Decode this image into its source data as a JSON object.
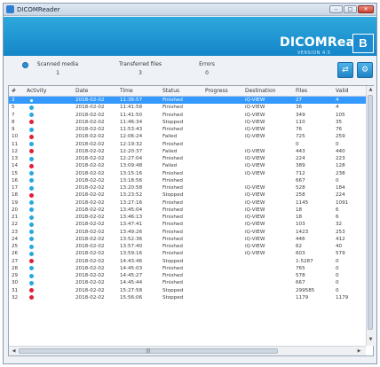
{
  "window": {
    "title": "DICOMReader",
    "min_glyph": "–",
    "max_glyph": "□",
    "close_glyph": "✕"
  },
  "banner": {
    "brand": "DICOMRead",
    "version": "VERSION 4.5",
    "badge": "B"
  },
  "status": {
    "scanned_label": "Scanned media",
    "scanned_value": "1",
    "transferred_label": "Transferred files",
    "transferred_value": "3",
    "errors_label": "Errors",
    "errors_value": "0"
  },
  "toolbar": {
    "btn1_glyph": "⇄",
    "btn2_glyph": "⚙"
  },
  "colors": {
    "accent": "#1f95d6",
    "selected_row": "#3399ff",
    "status_ok": "#2aa7e0",
    "status_error": "#e0203a"
  },
  "table": {
    "columns": [
      "#",
      "Activity",
      "Date",
      "Time",
      "Status",
      "Progress",
      "Destination",
      "Files",
      "Valid"
    ],
    "rows": [
      {
        "n": "3",
        "activity": "active",
        "date": "2018-02-02",
        "time": "11:36:57",
        "status": "Finished",
        "progress": "",
        "destination": "iQ-VIEW",
        "files": "27",
        "valid": "4",
        "selected": true
      },
      {
        "n": "5",
        "activity": "ok",
        "date": "2018-02-02",
        "time": "11:41:58",
        "status": "Finished",
        "progress": "",
        "destination": "iQ-VIEW",
        "files": "36",
        "valid": "4"
      },
      {
        "n": "7",
        "activity": "ok",
        "date": "2018-02-02",
        "time": "11:41:50",
        "status": "Finished",
        "progress": "",
        "destination": "iQ-VIEW",
        "files": "349",
        "valid": "105"
      },
      {
        "n": "8",
        "activity": "err",
        "date": "2018-02-02",
        "time": "11:46:34",
        "status": "Stopped",
        "progress": "",
        "destination": "iQ-VIEW",
        "files": "110",
        "valid": "35"
      },
      {
        "n": "9",
        "activity": "ok",
        "date": "2018-02-02",
        "time": "11:53:43",
        "status": "Finished",
        "progress": "",
        "destination": "iQ-VIEW",
        "files": "76",
        "valid": "76"
      },
      {
        "n": "10",
        "activity": "err",
        "date": "2018-02-02",
        "time": "12:06:24",
        "status": "Failed",
        "progress": "",
        "destination": "iQ-VIEW",
        "files": "725",
        "valid": "259"
      },
      {
        "n": "11",
        "activity": "ok",
        "date": "2018-02-02",
        "time": "12:19:32",
        "status": "Finished",
        "progress": "",
        "destination": "",
        "files": "0",
        "valid": "0"
      },
      {
        "n": "12",
        "activity": "err",
        "date": "2018-02-02",
        "time": "12:20:37",
        "status": "Failed",
        "progress": "",
        "destination": "iQ-VIEW",
        "files": "443",
        "valid": "440"
      },
      {
        "n": "13",
        "activity": "ok",
        "date": "2018-02-02",
        "time": "12:27:04",
        "status": "Finished",
        "progress": "",
        "destination": "iQ-VIEW",
        "files": "224",
        "valid": "223"
      },
      {
        "n": "14",
        "activity": "err",
        "date": "2018-02-02",
        "time": "13:09:48",
        "status": "Failed",
        "progress": "",
        "destination": "iQ-VIEW",
        "files": "389",
        "valid": "128"
      },
      {
        "n": "15",
        "activity": "ok",
        "date": "2018-02-02",
        "time": "13:15:16",
        "status": "Finished",
        "progress": "",
        "destination": "iQ-VIEW",
        "files": "712",
        "valid": "238"
      },
      {
        "n": "16",
        "activity": "ok",
        "date": "2018-02-02",
        "time": "13:18:56",
        "status": "Finished",
        "progress": "",
        "destination": "",
        "files": "667",
        "valid": "0"
      },
      {
        "n": "17",
        "activity": "ok",
        "date": "2018-02-02",
        "time": "13:20:58",
        "status": "Finished",
        "progress": "",
        "destination": "iQ-VIEW",
        "files": "528",
        "valid": "184"
      },
      {
        "n": "18",
        "activity": "err",
        "date": "2018-02-02",
        "time": "13:23:52",
        "status": "Stopped",
        "progress": "",
        "destination": "iQ-VIEW",
        "files": "258",
        "valid": "224"
      },
      {
        "n": "19",
        "activity": "ok",
        "date": "2018-02-02",
        "time": "13:27:16",
        "status": "Finished",
        "progress": "",
        "destination": "iQ-VIEW",
        "files": "1145",
        "valid": "1091"
      },
      {
        "n": "20",
        "activity": "ok",
        "date": "2018-02-02",
        "time": "13:45:04",
        "status": "Finished",
        "progress": "",
        "destination": "iQ-VIEW",
        "files": "18",
        "valid": "6"
      },
      {
        "n": "21",
        "activity": "ok",
        "date": "2018-02-02",
        "time": "13:46:13",
        "status": "Finished",
        "progress": "",
        "destination": "iQ-VIEW",
        "files": "18",
        "valid": "6"
      },
      {
        "n": "22",
        "activity": "ok",
        "date": "2018-02-02",
        "time": "13:47:41",
        "status": "Finished",
        "progress": "",
        "destination": "iQ-VIEW",
        "files": "103",
        "valid": "32"
      },
      {
        "n": "23",
        "activity": "ok",
        "date": "2018-02-02",
        "time": "13:49:26",
        "status": "Finished",
        "progress": "",
        "destination": "iQ-VIEW",
        "files": "1423",
        "valid": "253"
      },
      {
        "n": "24",
        "activity": "ok",
        "date": "2018-02-02",
        "time": "13:52:36",
        "status": "Finished",
        "progress": "",
        "destination": "iQ-VIEW",
        "files": "446",
        "valid": "412"
      },
      {
        "n": "25",
        "activity": "ok",
        "date": "2018-02-02",
        "time": "13:57:40",
        "status": "Finished",
        "progress": "",
        "destination": "iQ-VIEW",
        "files": "62",
        "valid": "40"
      },
      {
        "n": "26",
        "activity": "ok",
        "date": "2018-02-02",
        "time": "13:59:16",
        "status": "Finished",
        "progress": "",
        "destination": "iQ-VIEW",
        "files": "603",
        "valid": "579"
      },
      {
        "n": "27",
        "activity": "err",
        "date": "2018-02-02",
        "time": "14:43:46",
        "status": "Stopped",
        "progress": "",
        "destination": "",
        "files": "1:5287",
        "valid": "0"
      },
      {
        "n": "28",
        "activity": "ok",
        "date": "2018-02-02",
        "time": "14:45:03",
        "status": "Finished",
        "progress": "",
        "destination": "",
        "files": "765",
        "valid": "0"
      },
      {
        "n": "29",
        "activity": "ok",
        "date": "2018-02-02",
        "time": "14:45:27",
        "status": "Finished",
        "progress": "",
        "destination": "",
        "files": "578",
        "valid": "0"
      },
      {
        "n": "30",
        "activity": "ok",
        "date": "2018-02-02",
        "time": "14:45:44",
        "status": "Finished",
        "progress": "",
        "destination": "",
        "files": "667",
        "valid": "0"
      },
      {
        "n": "31",
        "activity": "err",
        "date": "2018-02-02",
        "time": "15:27:58",
        "status": "Stopped",
        "progress": "",
        "destination": "",
        "files": "299585",
        "valid": "0"
      },
      {
        "n": "32",
        "activity": "err",
        "date": "2018-02-02",
        "time": "15:56:06",
        "status": "Stopped",
        "progress": "",
        "destination": "",
        "files": "1179",
        "valid": "1179"
      }
    ]
  },
  "scrollbars": {
    "up_arrow": "▲",
    "down_arrow": "▼",
    "left_arrow": "◀",
    "right_arrow": "▶",
    "grip": "|||"
  }
}
